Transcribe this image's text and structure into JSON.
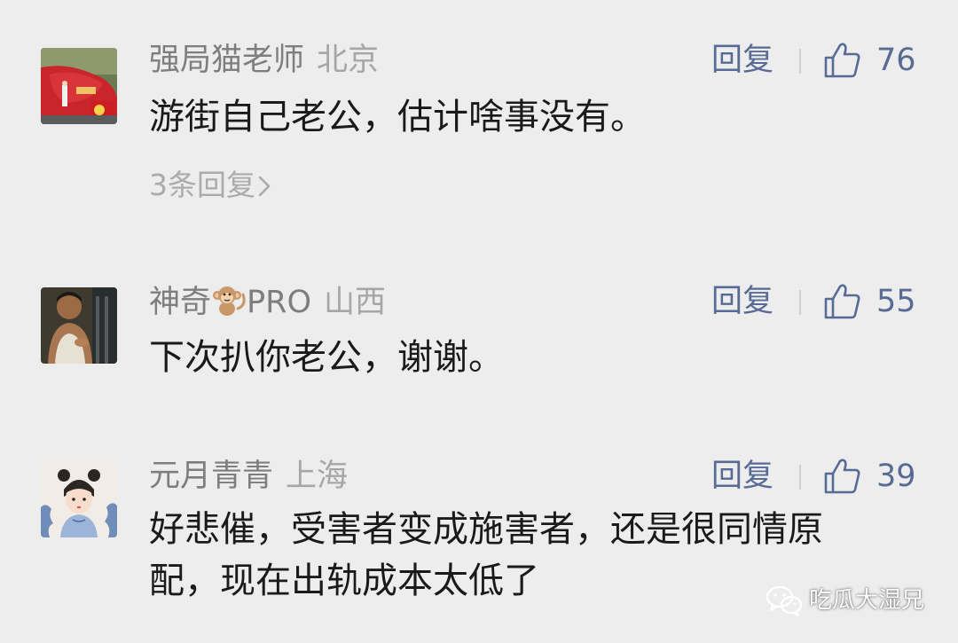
{
  "comments": [
    {
      "author": "强局猫老师",
      "location": "北京",
      "reply_label": "回复",
      "likes": "76",
      "text": "游街自己老公，估计啥事没有。",
      "sub_replies": "3条回复"
    },
    {
      "author_prefix": "神奇",
      "author_suffix": "PRO",
      "location": "山西",
      "reply_label": "回复",
      "likes": "55",
      "text": "下次扒你老公，谢谢。"
    },
    {
      "author": "元月青青",
      "location": "上海",
      "reply_label": "回复",
      "likes": "39",
      "text_line1": "好悲催，受害者变成施害者，还是很同情原",
      "text_line2": "配，现在出轨成本太低了"
    }
  ],
  "watermark": {
    "label": "吃瓜大湿兄"
  },
  "colors": {
    "background": "#ededed",
    "link": "#576b95",
    "name": "#7e7e7e",
    "location": "#a6a6a6",
    "text": "#1a1a1a"
  }
}
